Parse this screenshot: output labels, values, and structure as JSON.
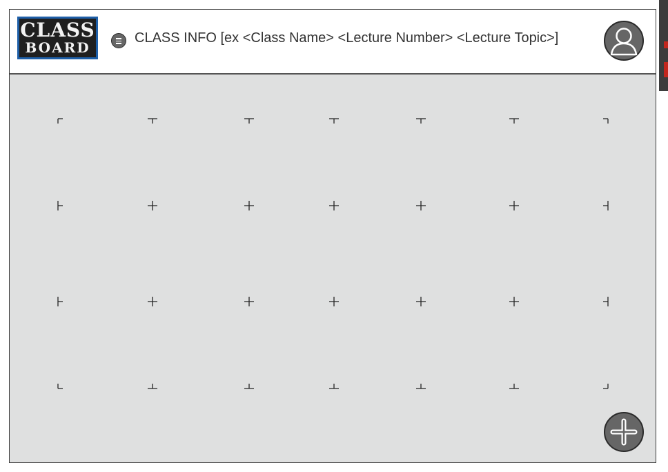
{
  "logo": {
    "line1": "CLASS",
    "line2": "BOARD"
  },
  "header": {
    "class_info": "CLASS INFO [ex <Class Name> <Lecture Number> <Lecture Topic>]",
    "menu_icon": "menu-icon",
    "avatar_icon": "user-avatar-icon"
  },
  "board": {
    "marks": "crop-mark-grid",
    "columns": 7,
    "rows": 4
  },
  "add_button": {
    "icon": "plus-circle-icon"
  },
  "colors": {
    "board_background": "#dfe0e0",
    "header_background": "#ffffff",
    "logo_border": "#1e5fa8",
    "button_fill": "#666666"
  }
}
